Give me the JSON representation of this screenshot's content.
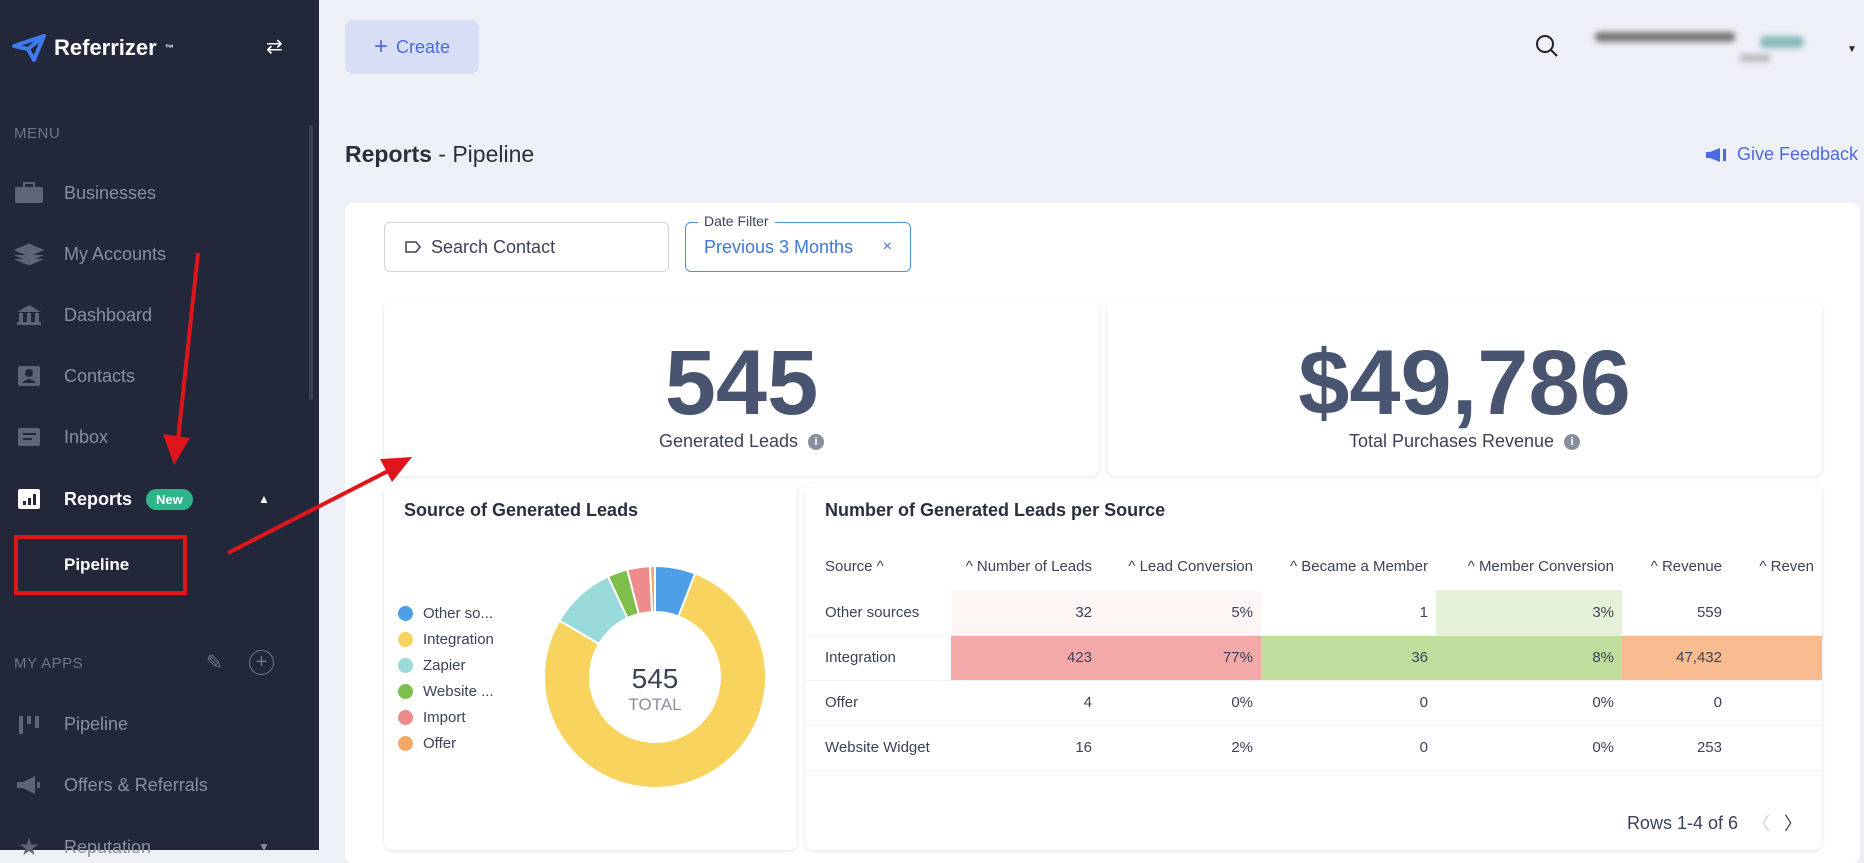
{
  "sidebar": {
    "brand": "Referrizer",
    "brand_tm": "™",
    "menu_label": "MENU",
    "items": [
      {
        "label": "Businesses",
        "icon": "briefcase-icon"
      },
      {
        "label": "My Accounts",
        "icon": "layers-icon"
      },
      {
        "label": "Dashboard",
        "icon": "bank-icon"
      },
      {
        "label": "Contacts",
        "icon": "contact-card-icon"
      },
      {
        "label": "Inbox",
        "icon": "inbox-icon"
      },
      {
        "label": "Reports",
        "icon": "bar-chart-icon",
        "badge": "New"
      }
    ],
    "subitem": "Pipeline",
    "apps_label": "MY APPS",
    "apps": [
      {
        "label": "Pipeline",
        "icon": "kanban-icon"
      },
      {
        "label": "Offers & Referrals",
        "icon": "megaphone-icon"
      },
      {
        "label": "Reputation",
        "icon": "star-icon"
      }
    ]
  },
  "header": {
    "create_label": "Create",
    "title_bold": "Reports",
    "title_rest": " - Pipeline",
    "feedback": "Give Feedback"
  },
  "filters": {
    "search_placeholder": "Search Contact",
    "date_label": "Date Filter",
    "date_value": "Previous 3 Months"
  },
  "kpis": [
    {
      "value": "545",
      "label": "Generated Leads"
    },
    {
      "value": "$49,786",
      "label": "Total Purchases Revenue"
    }
  ],
  "chart_data": {
    "type": "pie",
    "title": "Source of Generated Leads",
    "center_value": "545",
    "center_label": "TOTAL",
    "categories": [
      "Other so...",
      "Integration",
      "Zapier",
      "Website ...",
      "Import",
      "Offer"
    ],
    "values": [
      32,
      423,
      52,
      16,
      18,
      4
    ],
    "colors": [
      "#4f9fe6",
      "#f8d35e",
      "#98d9d9",
      "#7dbf4a",
      "#ef8b8b",
      "#f3a86a"
    ]
  },
  "table": {
    "title": "Number of Generated Leads per Source",
    "columns": [
      "Source ^",
      "^ Number of Leads",
      "^ Lead Conversion",
      "^ Became a Member",
      "^ Member Conversion",
      "^ Revenue",
      "^ Reven"
    ],
    "rows": [
      [
        "Other sources",
        "32",
        "5%",
        "1",
        "3%",
        "559",
        ""
      ],
      [
        "Integration",
        "423",
        "77%",
        "36",
        "8%",
        "47,432",
        ""
      ],
      [
        "Offer",
        "4",
        "0%",
        "0",
        "0%",
        "0",
        ""
      ],
      [
        "Website Widget",
        "16",
        "2%",
        "0",
        "0%",
        "253",
        ""
      ]
    ],
    "pagination": "Rows 1-4 of 6"
  }
}
